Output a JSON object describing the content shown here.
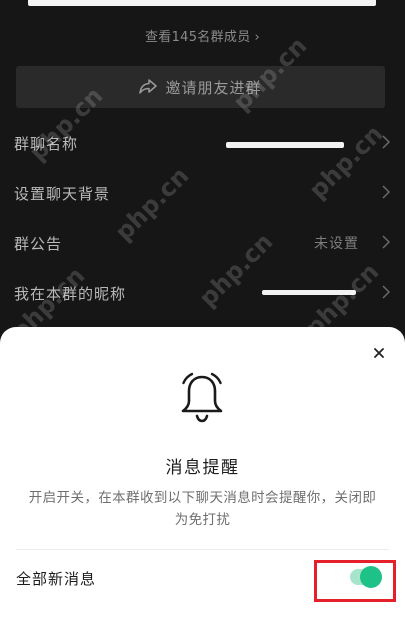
{
  "group": {
    "members_link": "查看145名群成员",
    "invite_button": "邀请朋友进群"
  },
  "settings": [
    {
      "label": "群聊名称",
      "value": ""
    },
    {
      "label": "设置聊天背景",
      "value": ""
    },
    {
      "label": "群公告",
      "value": "未设置"
    },
    {
      "label": "我在本群的昵称",
      "value": ""
    }
  ],
  "watermark_text": "php.cn",
  "sheet": {
    "title": "消息提醒",
    "description": "开启开关，在本群收到以下聊天消息时会提醒你，关闭即为免打扰",
    "toggle_label": "全部新消息",
    "toggle_on": true
  },
  "icons": {
    "close": "close-icon",
    "bell": "bell-icon",
    "share": "share-icon",
    "chevron": "chevron-right-icon"
  },
  "colors": {
    "toggle_on": "#1ec187",
    "highlight": "#e5202a"
  }
}
